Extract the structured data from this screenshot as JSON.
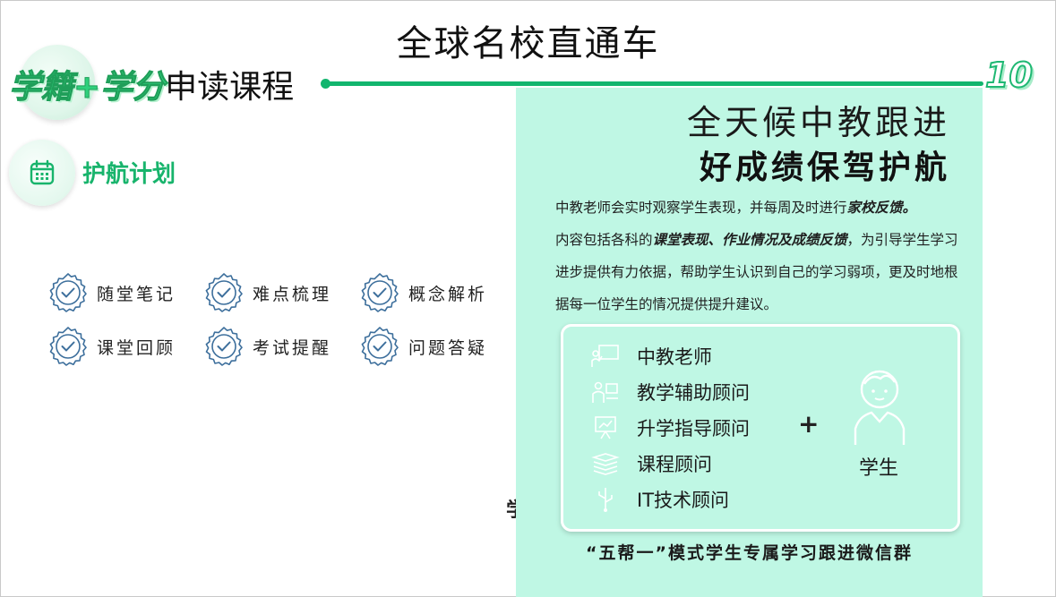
{
  "header": {
    "main_title": "全球名校直通车",
    "subtitle_green": "学籍+学分",
    "subtitle_plain": "申读课程",
    "page_number": "10"
  },
  "section": {
    "label": "护航计划",
    "icon": "calendar-icon"
  },
  "features": [
    {
      "label": "随堂笔记"
    },
    {
      "label": "难点梳理"
    },
    {
      "label": "概念解析"
    },
    {
      "label": "课堂回顾"
    },
    {
      "label": "考试提醒"
    },
    {
      "label": "问题答疑"
    }
  ],
  "stray_char": "学",
  "panel": {
    "heading_line1": "全天候中教跟进",
    "heading_line2": "好成绩保驾护航",
    "desc": {
      "p1_a": "中教老师会实时观察学生表现，并每周及时进行",
      "p1_b": "家校反馈。",
      "p2_a": "内容包括各科的",
      "p2_b": "课堂表现、作业情况及成绩反馈",
      "p2_c": "，为引导学生学习进步提供有力依据，帮助学生认识到自己的学习弱项，更及时地根据每一位学生的情况提供提升建议。"
    },
    "team": [
      {
        "label": "中教老师",
        "icon": "teacher-board-icon"
      },
      {
        "label": "教学辅助顾问",
        "icon": "assistant-icon"
      },
      {
        "label": "升学指导顾问",
        "icon": "presentation-icon"
      },
      {
        "label": "课程顾问",
        "icon": "books-icon"
      },
      {
        "label": "IT技术顾问",
        "icon": "usb-icon"
      }
    ],
    "plus_sign": "+",
    "student_label": "学生",
    "group_text": "“五帮一”模式学生专属学习跟进微信群"
  },
  "colors": {
    "accent_green": "#12b56e",
    "panel_bg": "#bff7e4",
    "badge_blue": "#3d6f9c"
  }
}
